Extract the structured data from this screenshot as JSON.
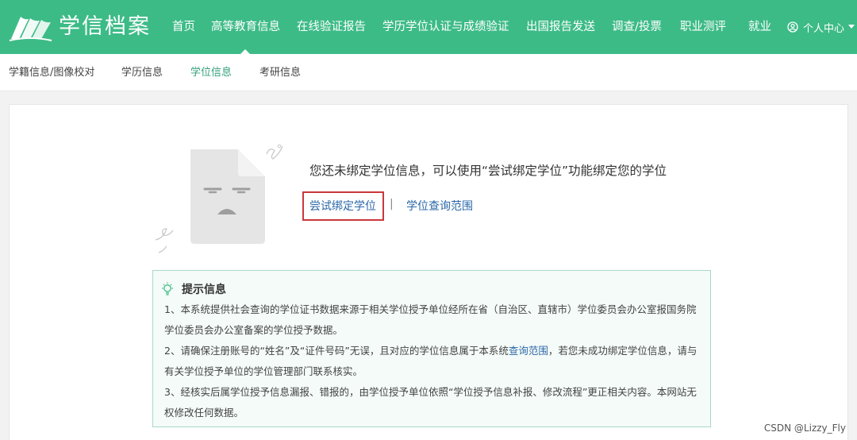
{
  "header": {
    "logo_text": "学信档案",
    "nav": [
      {
        "label": "首页"
      },
      {
        "label": "高等教育信息"
      },
      {
        "label": "在线验证报告"
      },
      {
        "label": "学历学位认证与成绩验证"
      },
      {
        "label": "出国报告发送"
      },
      {
        "label": "调查/投票"
      },
      {
        "label": "职业测评"
      },
      {
        "label": "就业"
      }
    ],
    "active_nav": "高等教育信息",
    "user_label": "个人中心"
  },
  "subnav": {
    "items": [
      {
        "label": "学籍信息/图像校对"
      },
      {
        "label": "学历信息"
      },
      {
        "label": "学位信息"
      },
      {
        "label": "考研信息"
      }
    ],
    "active": "学位信息"
  },
  "main": {
    "message": "您还未绑定学位信息，可以使用“尝试绑定学位”功能绑定您的学位",
    "try_bind_link": "尝试绑定学位",
    "separator": "|",
    "query_scope_link": "学位查询范围"
  },
  "tips": {
    "title": "提示信息",
    "p1": "1、本系统提供社会查询的学位证书数据来源于相关学位授予单位经所在省（自治区、直辖市）学位委员会办公室报国务院学位委员会办公室备案的学位授予数据。",
    "p2_before": "2、请确保注册账号的“姓名”及“证件号码”无误，且对应的学位信息属于本系统",
    "p2_link": "查询范围",
    "p2_after": "，若您未成功绑定学位信息，请与有关学位授予单位的学位管理部门联系核实。",
    "p3": "3、经核实后属学位授予信息漏报、错报的，由学位授予单位依照“学位授予信息补报、修改流程”更正相关内容。本网站无权修改任何数据。"
  },
  "watermark": "CSDN @Lizzy_Fly",
  "colors": {
    "brand_green": "#3dbb87",
    "active_tab": "#34a07a",
    "link_blue": "#2b67a8",
    "highlight_red": "#c9383c",
    "tips_bg": "#f4fbf8",
    "tips_border": "#a9d9c5"
  },
  "icons": {
    "logo": "book-logo-icon",
    "user": "user-circle-icon",
    "dropdown": "caret-down-icon",
    "tips": "lightbulb-icon",
    "empty_state": "sad-document-icon"
  }
}
